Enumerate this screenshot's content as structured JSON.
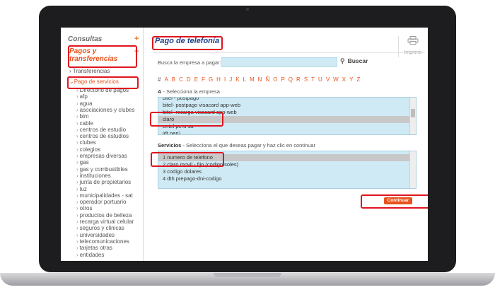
{
  "sidebar": {
    "consultas": "Consultas",
    "plus": "+",
    "pagos": "Pagos y transferencias",
    "transferencias": "Transferencias",
    "pago_servicios": "Pago de servicios",
    "categories": [
      "Directorio de pagos",
      "afp",
      "agua",
      "asociaciones y clubes",
      "bim",
      "cable",
      "centros de estudio",
      "centros de estudios",
      "clubes",
      "colegios",
      "empresas diversas",
      "gas",
      "gas y combustibles",
      "instituciones",
      "junta de propietarios",
      "luz",
      "municipalidades - sat",
      "operador portuario",
      "otros",
      "productos de belleza",
      "recarga virtual celular",
      "seguros y clinicas",
      "universidades",
      "telecomunicaciones",
      "tarjetas otras",
      "entidades"
    ]
  },
  "main": {
    "title": "Pago de telefonía",
    "print_label": "Imprimir",
    "search_label": "Busca la empresa a pagar:",
    "search_value": "",
    "search_button": "Buscar",
    "alphabet": [
      "#",
      "A",
      "B",
      "C",
      "D",
      "E",
      "F",
      "G",
      "H",
      "I",
      "J",
      "K",
      "L",
      "M",
      "N",
      "Ñ",
      "O",
      "P",
      "Q",
      "R",
      "S",
      "T",
      "U",
      "V",
      "W",
      "X",
      "Y",
      "Z"
    ],
    "section_a_label": "A",
    "section_a_text": " - Selecciona la empresa",
    "empresas": [
      "bitel - postpago",
      "bitel- postpago visacard app-web",
      "bitel- recarga visacard app-web",
      "claro",
      "entel peru sa",
      "idt perú"
    ],
    "servicios_label": "Servicios",
    "servicios_text": " - Selecciona el que deseas pagar y haz clic en continuar",
    "servicios": [
      "1 numero de telefono",
      "2 claro movil - fijo (codigo soles)",
      "3 codigo dolares",
      "4 dth prepago-dni-codigo"
    ],
    "continue_label": "Continuar"
  },
  "colors": {
    "accent": "#e8521c",
    "title": "#1b3f8b",
    "list_bg": "#cfeaf5",
    "annotation": "#e0141e"
  }
}
